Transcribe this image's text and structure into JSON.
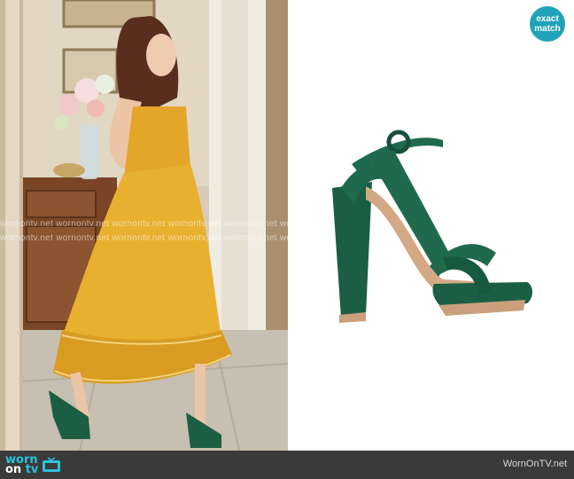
{
  "badge": {
    "line1": "exact",
    "line2": "match"
  },
  "footer": {
    "logo_part1": "worn",
    "logo_part2": "on",
    "logo_part3": "tv",
    "site": "WornOnTV.net"
  },
  "watermark": {
    "row1": "wornontv.net  wornontv.net  wornontv.net  wornontv.net  wornontv.net  worno",
    "row2": "wornontv.net  wornontv.net  wornontv.net  wornontv.net  wornontv.net  worno"
  },
  "colors": {
    "badge": "#1fa3b8",
    "footer": "#3a3a3a",
    "logo_accent": "#29c2dd",
    "dress": "#e3a628",
    "shoe": "#1c5e44"
  }
}
